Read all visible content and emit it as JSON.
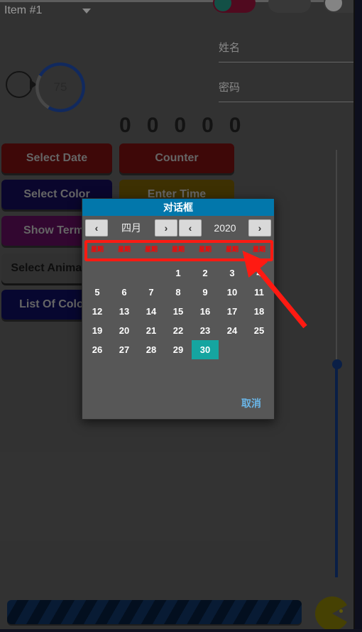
{
  "background_app": {
    "spinner": {
      "label": "Item #1",
      "icon": "chevron-down-icon"
    },
    "circular_progress": {
      "value": "75"
    },
    "counter_digits": [
      "0",
      "0",
      "0",
      "0",
      "0"
    ],
    "fields": [
      {
        "label": "姓名",
        "value": ""
      },
      {
        "label": "密码",
        "value": ""
      }
    ],
    "buttons": [
      {
        "label": "Select Date",
        "color": "#5e0d0d"
      },
      {
        "label": "Counter",
        "color": "#5e0d0d"
      },
      {
        "label": "Select Color",
        "color": "#100a45"
      },
      {
        "label": "Enter Time",
        "color": "#5d4a04"
      },
      {
        "label": "Show Terms",
        "color": "#4d0c4a"
      },
      {
        "label": "Select Animation",
        "color": "#4a4a4a"
      },
      {
        "label": "List Of Colors",
        "color": "#0b0b4a"
      }
    ],
    "toggles": [
      {
        "name": "toggle-1",
        "state": "on"
      },
      {
        "name": "toggle-2",
        "state": "off"
      },
      {
        "name": "toggle-3",
        "state": "off"
      }
    ]
  },
  "dialog": {
    "title": "对话框",
    "month": {
      "prev_icon": "chevron-left-icon",
      "label": "四月",
      "next_icon": "chevron-right-icon"
    },
    "year": {
      "prev_icon": "chevron-left-icon",
      "label": "2020",
      "next_icon": "chevron-right-icon"
    },
    "weekday_headers": [
      "星期",
      "星期",
      "星期",
      "星期",
      "星期",
      "星期",
      "星期"
    ],
    "weekday_color": "#ff0000",
    "days": [
      "",
      "",
      "",
      "1",
      "2",
      "3",
      "4",
      "5",
      "6",
      "7",
      "8",
      "9",
      "10",
      "11",
      "12",
      "13",
      "14",
      "15",
      "16",
      "17",
      "18",
      "19",
      "20",
      "21",
      "22",
      "23",
      "24",
      "25",
      "26",
      "27",
      "28",
      "29",
      "30",
      "",
      "",
      ""
    ],
    "selected_day": "30",
    "selected_color": "#15a5a0",
    "cancel_label": "取消",
    "cancel_color": "#6ab6e8",
    "title_bar_color": "#0277ab"
  },
  "annotation": {
    "highlight_color": "#ff1a12",
    "arrow_color": "#ff1a12",
    "target": "weekday-header-row"
  }
}
